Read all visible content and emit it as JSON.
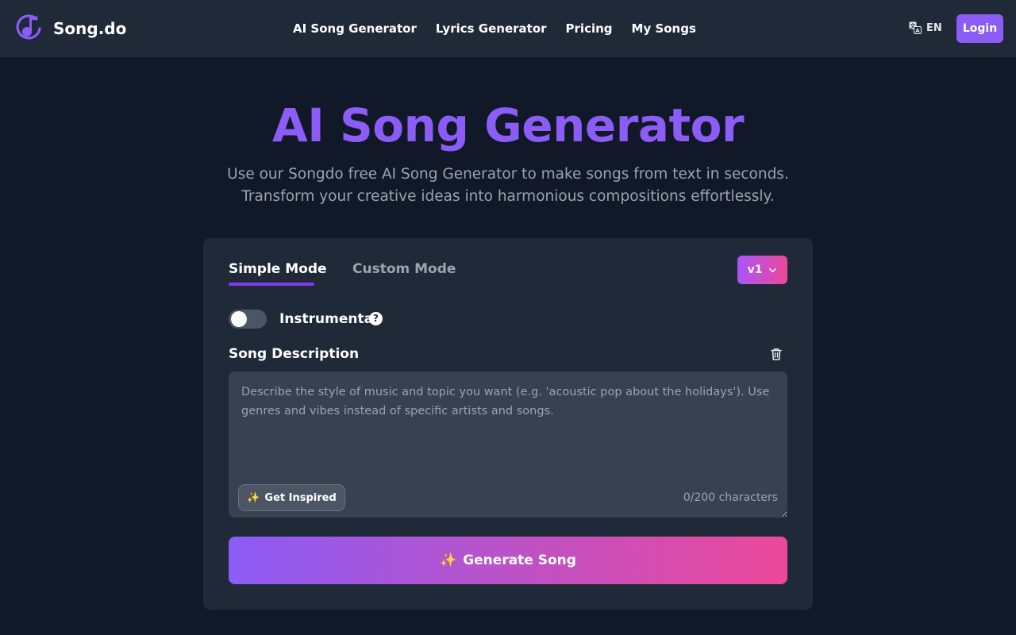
{
  "header": {
    "brand": "Song.do",
    "nav": [
      "AI Song Generator",
      "Lyrics Generator",
      "Pricing",
      "My Songs"
    ],
    "language": "EN",
    "login_label": "Login"
  },
  "hero": {
    "title": "AI Song Generator",
    "subtitle": "Use our Songdo free AI Song Generator to make songs from text in seconds. Transform your creative ideas into harmonious compositions effortlessly."
  },
  "card": {
    "tabs": [
      "Simple Mode",
      "Custom Mode"
    ],
    "active_tab": "Simple Mode",
    "version": "v1",
    "instrumental_label": "Instrumental",
    "instrumental_enabled": false,
    "help_symbol": "?",
    "description_label": "Song Description",
    "description_value": "",
    "description_placeholder": "Describe the style of music and topic you want (e.g. 'acoustic pop about the holidays'). Use genres and vibes instead of specific artists and songs.",
    "inspire_label": "Get Inspired",
    "char_count": "0/200 characters",
    "generate_label": "Generate Song",
    "spark_glyph": "✨"
  },
  "colors": {
    "accent": "#8b5cf6",
    "gradient_end": "#ec4899",
    "background": "#111827",
    "surface": "#1f2937"
  }
}
